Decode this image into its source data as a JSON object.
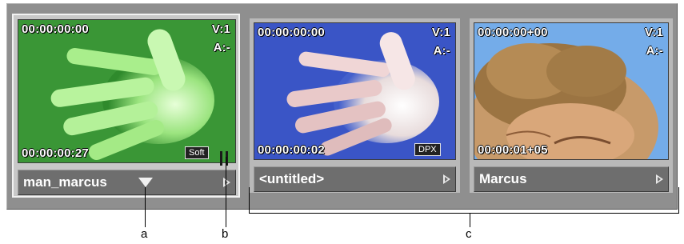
{
  "clips": [
    {
      "name": "man_marcus",
      "timecode_top": "00:00:00:00",
      "video_track": "V:1",
      "audio_track": "A:-",
      "timecode_bottom": "00:00:00:27",
      "badge": "Soft",
      "selected": true,
      "thumbnail_color": "#3f9a3a"
    },
    {
      "name": "<untitled>",
      "timecode_top": "00:00:00:00",
      "video_track": "V:1",
      "audio_track": "A:-",
      "timecode_bottom": "00:00:00:02",
      "badge": "DPX",
      "selected": false,
      "thumbnail_color": "#3b55c8"
    },
    {
      "name": "Marcus",
      "timecode_top": "00:00:00+00",
      "video_track": "V:1",
      "audio_track": "A:-",
      "timecode_bottom": "00:00:01+05",
      "badge": "",
      "selected": false,
      "thumbnail_color": "#6fa8ea"
    }
  ],
  "callouts": {
    "a": "a",
    "b": "b",
    "c": "c"
  },
  "icons": {
    "dropdown": "dropdown-triangle-icon",
    "play": "play-arrow-icon",
    "trim": "trim-bracket-icon"
  },
  "colors": {
    "background": "#8f8f8f",
    "name_bar": "#6e6e6e",
    "selected_border": "#f2f2f2"
  }
}
